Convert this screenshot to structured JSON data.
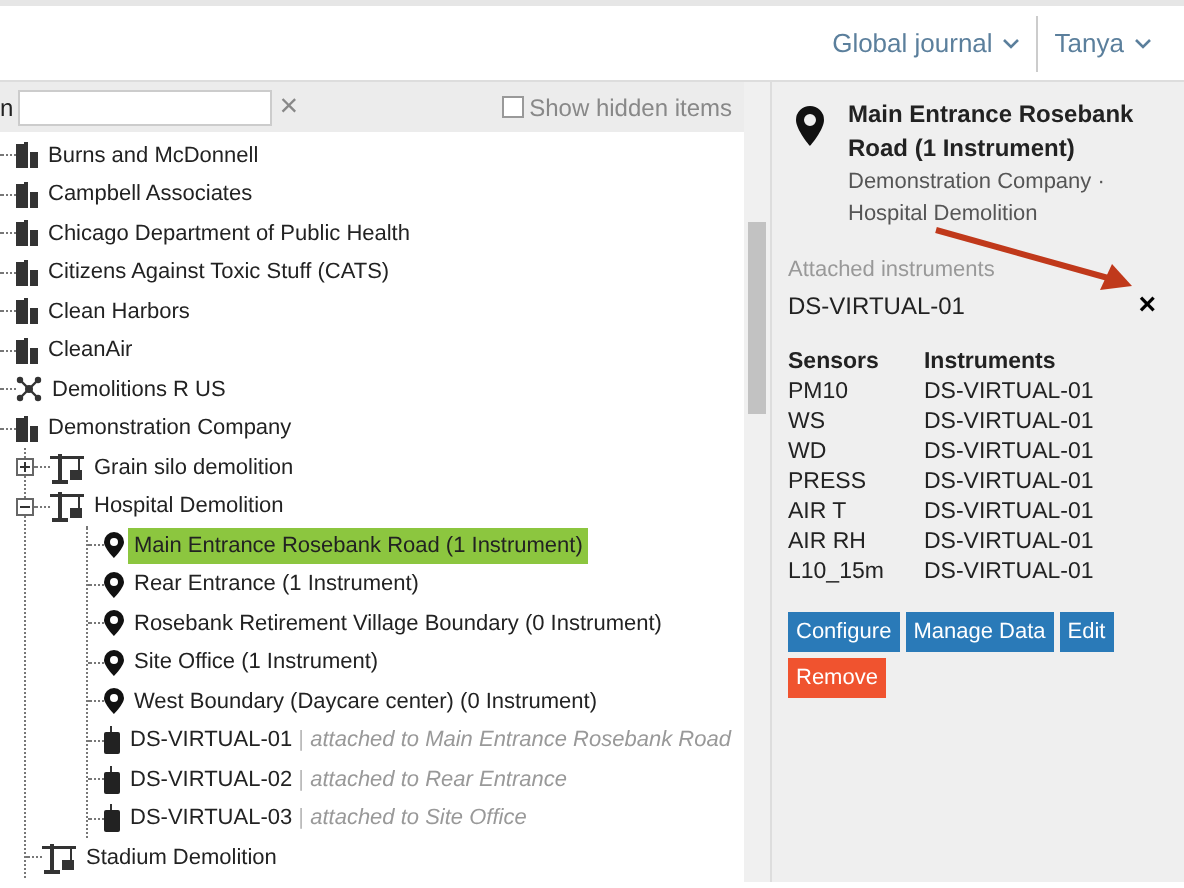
{
  "header": {
    "menus": [
      {
        "label": "Global journal"
      },
      {
        "label": "Tanya"
      }
    ]
  },
  "toolbar": {
    "search_label": "n",
    "clear": "×",
    "show_hidden": {
      "label": "Show hidden items",
      "checked": false
    }
  },
  "tree": [
    {
      "kind": "company",
      "label": "Burns and McDonnell",
      "selected": false
    },
    {
      "kind": "company",
      "label": "Campbell Associates",
      "selected": false
    },
    {
      "kind": "company",
      "label": "Chicago Department of Public Health",
      "selected": false
    },
    {
      "kind": "company",
      "label": "Citizens Against Toxic Stuff (CATS)",
      "selected": false
    },
    {
      "kind": "company",
      "label": "Clean Harbors",
      "selected": false
    },
    {
      "kind": "company",
      "label": "CleanAir",
      "selected": false
    },
    {
      "kind": "network",
      "label": "Demolitions R US",
      "selected": false
    },
    {
      "kind": "company",
      "label": "Demonstration Company",
      "selected": false,
      "children": [
        {
          "kind": "project",
          "label": "Grain silo demolition",
          "selected": false,
          "expanded": false
        },
        {
          "kind": "project",
          "label": "Hospital Demolition",
          "selected": false,
          "expanded": true,
          "children": [
            {
              "kind": "location",
              "label": "Main Entrance Rosebank Road (1 Instrument)",
              "selected": true
            },
            {
              "kind": "location",
              "label": "Rear Entrance (1 Instrument)",
              "selected": false
            },
            {
              "kind": "location",
              "label": "Rosebank Retirement Village Boundary (0 Instrument)",
              "selected": false
            },
            {
              "kind": "location",
              "label": "Site Office (1 Instrument)",
              "selected": false
            },
            {
              "kind": "location",
              "label": "West Boundary (Daycare center) (0 Instrument)",
              "selected": false
            },
            {
              "kind": "instrument",
              "label": "DS-VIRTUAL-01",
              "separator": "|",
              "note": "attached to Main Entrance Rosebank Road",
              "selected": false
            },
            {
              "kind": "instrument",
              "label": "DS-VIRTUAL-02",
              "separator": "|",
              "note": "attached to Rear Entrance",
              "selected": false
            },
            {
              "kind": "instrument",
              "label": "DS-VIRTUAL-03",
              "separator": "|",
              "note": "attached to Site Office",
              "selected": false
            }
          ]
        },
        {
          "kind": "project",
          "label": "Stadium Demolition",
          "selected": false
        }
      ]
    }
  ],
  "details": {
    "title": "Main Entrance Rosebank Road (1 Instrument)",
    "subtitle": "Demonstration Company · Hospital Demolition",
    "attached_label": "Attached instruments",
    "attached_value": "DS-VIRTUAL-01",
    "detach": "×",
    "columns": [
      "Sensors",
      "Instruments"
    ],
    "rows": [
      [
        "PM10",
        "DS-VIRTUAL-01"
      ],
      [
        "WS",
        "DS-VIRTUAL-01"
      ],
      [
        "WD",
        "DS-VIRTUAL-01"
      ],
      [
        "PRESS",
        "DS-VIRTUAL-01"
      ],
      [
        "AIR T",
        "DS-VIRTUAL-01"
      ],
      [
        "AIR RH",
        "DS-VIRTUAL-01"
      ],
      [
        "L10_15m",
        "DS-VIRTUAL-01"
      ]
    ],
    "buttons": [
      {
        "label": "Configure",
        "kind": "primary"
      },
      {
        "label": "Manage Data",
        "kind": "primary"
      },
      {
        "label": "Edit",
        "kind": "primary"
      },
      {
        "label": "Remove",
        "kind": "danger"
      }
    ]
  }
}
